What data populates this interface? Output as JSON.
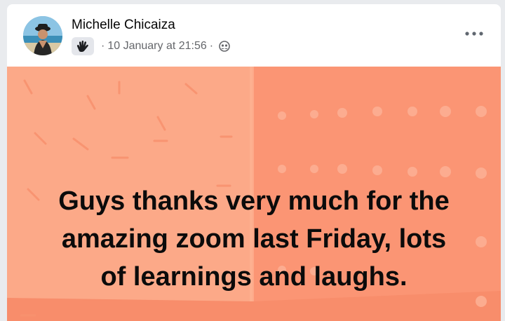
{
  "post": {
    "author": "Michelle Chicaiza",
    "badge_icon": "waving-hand-icon",
    "separator": "·",
    "timestamp": "10 January at 21:56",
    "audience_icon": "friends-group-icon",
    "more_icon": "more-options-icon",
    "body_text": "Guys thanks very much for the\namazing zoom last Friday, lots\nof learnings and laughs.",
    "background_color": "#fb9b78",
    "accent_colors": {
      "left_wall": "#fca988",
      "right_wall": "#fb9574",
      "floor": "#f88d6b"
    }
  }
}
